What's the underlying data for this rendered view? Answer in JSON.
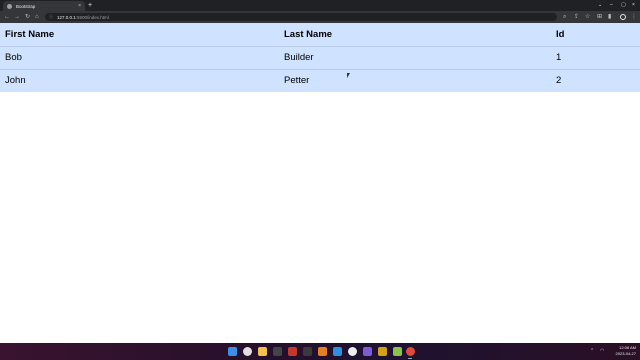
{
  "browser": {
    "tab_title": "Bootstrap",
    "tab_close": "×",
    "new_tab": "+",
    "url_host": "127.0.0.1",
    "url_path": ":5500/index.html",
    "window_controls": {
      "minimize": "–",
      "maximize": "▢",
      "close": "×"
    }
  },
  "table": {
    "headers": [
      "First Name",
      "Last Name",
      "Id"
    ],
    "rows": [
      [
        "Bob",
        "Builder",
        "1"
      ],
      [
        "John",
        "Petter",
        "2"
      ]
    ],
    "background_color": "#cfe2ff"
  },
  "taskbar": {
    "time": "12:08 AM",
    "date": "2023-04-27",
    "pinned_icons": [
      "windows-start-icon",
      "search-icon",
      "chrome-icon",
      "file-explorer-icon",
      "terminal-icon",
      "app-icon",
      "folder-icon",
      "vscode-icon",
      "app-icon",
      "app-icon",
      "app-icon",
      "app-icon",
      "app-icon",
      "chrome-icon"
    ]
  }
}
